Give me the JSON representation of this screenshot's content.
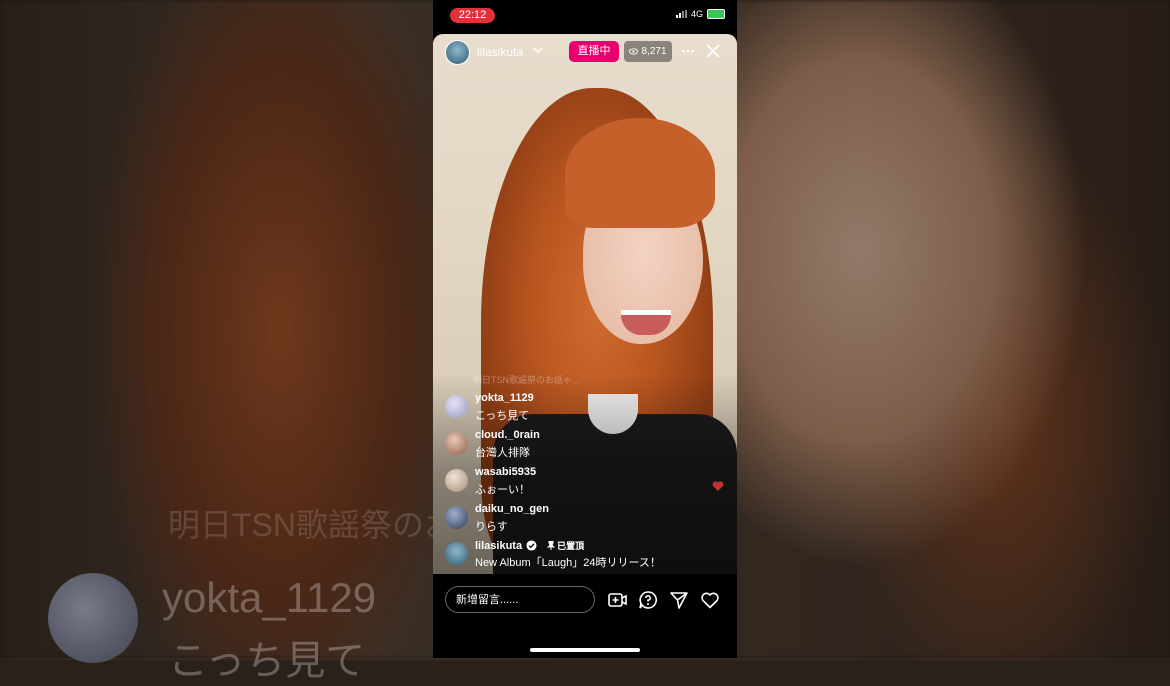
{
  "background": {
    "stream_text_line": "明日TSN歌謡祭のお話でした...",
    "username": "yokta_1129",
    "message": "こっち見て"
  },
  "status_bar": {
    "time": "22:12",
    "network": "4G"
  },
  "top_bar": {
    "host_name": "lilasikuta",
    "live_label": "直播中",
    "viewer_count": "8,271"
  },
  "faint_overlay_text": "明日TSN歌謡祭のお話ゃ...",
  "comments": [
    {
      "user": "yokta_1129",
      "text": "こっち見て",
      "avatar_color": "#b8b6d6"
    },
    {
      "user": "cloud._0rain",
      "text": "台灣人排隊",
      "avatar_color": "#c9a08a"
    },
    {
      "user": "wasabi5935",
      "text": "ふぉーい！",
      "avatar_color": "#d8c8b8"
    },
    {
      "user": "daiku_no_gen",
      "text": "りらす",
      "avatar_color": "#5c6b8a"
    }
  ],
  "pinned_comment": {
    "user": "lilasikuta",
    "pinned_label": "已置頂",
    "text": "New Album「Laugh」24時リリース！"
  },
  "bottom_bar": {
    "comment_placeholder": "新增留言......"
  },
  "colors": {
    "live_badge": "#e6006f",
    "time_pill": "#e0323b",
    "battery": "#34c759"
  },
  "icons": [
    "chevron-down-icon",
    "eye-icon",
    "more-icon",
    "close-icon",
    "verified-icon",
    "pin-icon",
    "add-media-icon",
    "question-icon",
    "send-icon",
    "heart-icon"
  ]
}
